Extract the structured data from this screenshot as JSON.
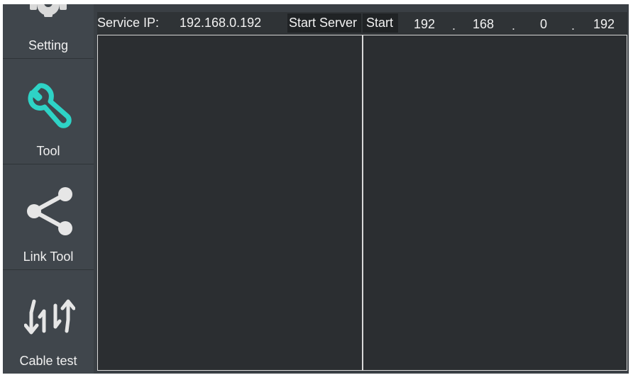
{
  "sidebar": {
    "items": [
      {
        "label": "Setting",
        "icon": "gear-icon"
      },
      {
        "label": "Tool",
        "icon": "wrench-icon",
        "active": true
      },
      {
        "label": "Link Tool",
        "icon": "share-icon"
      },
      {
        "label": "Cable test",
        "icon": "cable-test-icon"
      }
    ]
  },
  "topbar": {
    "service_ip_label": "Service IP:",
    "service_ip_value": "192.168.0.192",
    "start_server_label": "Start Server",
    "start_label": "Start",
    "ip_octets": [
      "192",
      "168",
      "0",
      "192"
    ],
    "ip_separator": "."
  },
  "colors": {
    "accent": "#2ed3c6",
    "sidebar_bg": "#40464c",
    "panel_bg": "#2b2e31"
  }
}
